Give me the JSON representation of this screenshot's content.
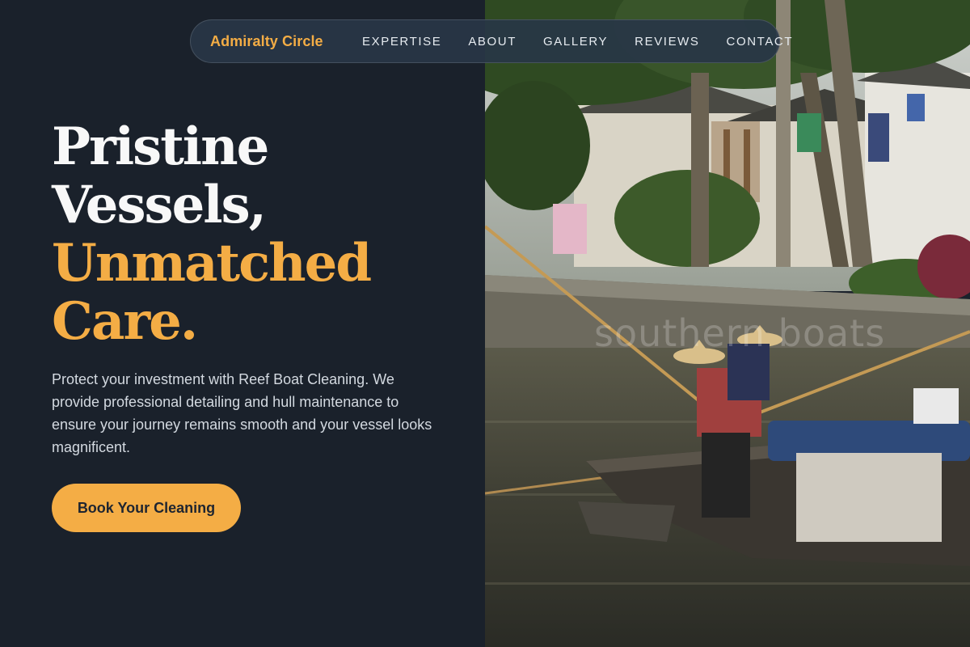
{
  "nav": {
    "brand": "Admiralty Circle",
    "items": [
      {
        "label": "EXPERTISE"
      },
      {
        "label": "ABOUT"
      },
      {
        "label": "GALLERY"
      },
      {
        "label": "REVIEWS"
      },
      {
        "label": "CONTACT"
      }
    ]
  },
  "hero": {
    "headline_line1": "Pristine",
    "headline_line2": "Vessels,",
    "headline_line3": "Unmatched",
    "headline_line4": "Care.",
    "description": "Protect your investment with Reef Boat Cleaning. We provide professional detailing and hull maintenance to ensure your journey remains smooth and your vessel looks magnificent.",
    "cta_label": "Book Your Cleaning"
  },
  "photo": {
    "watermark": "southern boats"
  },
  "colors": {
    "background": "#1a212b",
    "accent": "#f4ad45",
    "nav_background": "#283646"
  }
}
